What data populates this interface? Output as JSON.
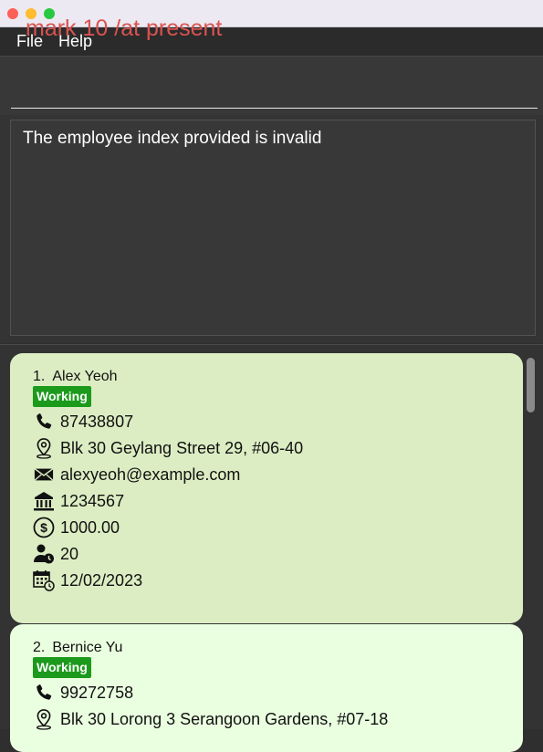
{
  "menu": {
    "file": "File",
    "help": "Help"
  },
  "command": {
    "value": "mark 10 /at present"
  },
  "result": {
    "message": "The employee index provided is invalid"
  },
  "employees": [
    {
      "index": "1.",
      "name": "Alex Yeoh",
      "status": "Working",
      "phone": "87438807",
      "address": "Blk 30 Geylang Street 29, #06-40",
      "email": "alexyeoh@example.com",
      "bank": "1234567",
      "salary": "1000.00",
      "leave": "20",
      "date": "12/02/2023"
    },
    {
      "index": "2.",
      "name": "Bernice Yu",
      "status": "Working",
      "phone": "99272758",
      "address": "Blk 30 Lorong 3 Serangoon Gardens, #07-18"
    }
  ],
  "colors": {
    "command_text": "#d9534f",
    "card_1_bg": "#dcedc3",
    "card_2_bg": "#eaffe0",
    "badge_bg": "#1c9a1c"
  },
  "icons": [
    "phone-icon",
    "location-icon",
    "email-icon",
    "bank-icon",
    "salary-icon",
    "leave-icon",
    "calendar-icon"
  ]
}
